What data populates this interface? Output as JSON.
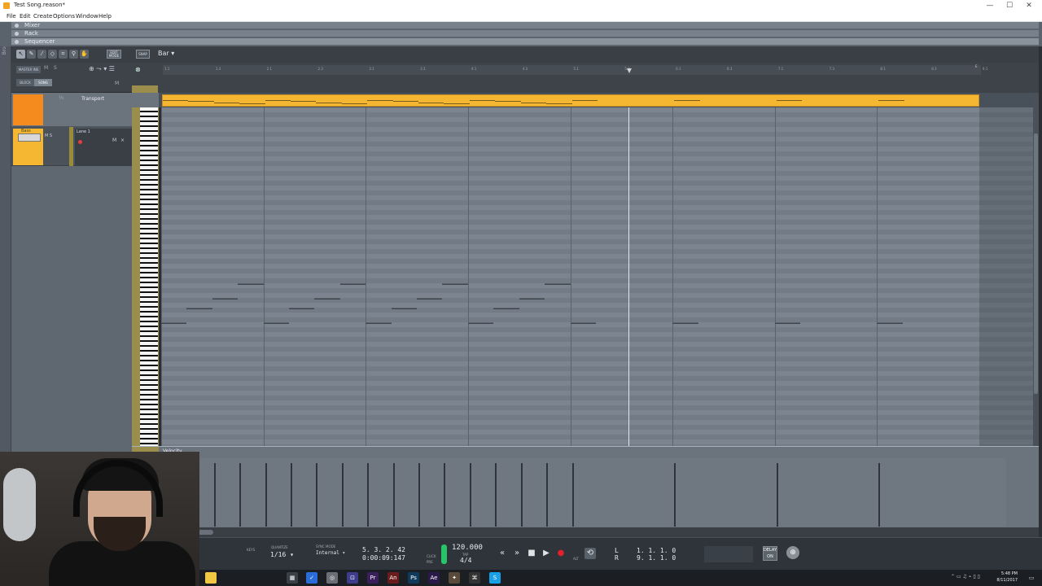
{
  "window": {
    "title": "Test Song.reason*",
    "minimize": "—",
    "maximize": "☐",
    "close": "✕"
  },
  "menu": [
    "File",
    "Edit",
    "Create",
    "Options",
    "Window",
    "Help"
  ],
  "areas": {
    "mixer": "Mixer",
    "rack": "Rack",
    "sequencer": "Sequencer"
  },
  "browser_tab": "Browser",
  "tools": {
    "edit_mode": "EDIT MODE"
  },
  "track_header": {
    "master_inst": "MASTER INS",
    "block": "BLOCK",
    "song": "SONG",
    "m": "M",
    "s": "S",
    "m2": "M"
  },
  "tracks": {
    "transport": {
      "name": "Transport"
    },
    "bass": {
      "device": "Bass",
      "m": "M",
      "s": "S",
      "lane": "Lane 1",
      "lane_m": "M",
      "lane_x": "×"
    }
  },
  "editor": {
    "snap_button": "SNAP",
    "snap_value": "Bar",
    "ruler_ticks": [
      "1.1",
      "1.3",
      "2.1",
      "2.3",
      "3.1",
      "3.3",
      "4.1",
      "4.3",
      "5.1",
      "5.3",
      "6.1",
      "6.3",
      "7.1",
      "7.3",
      "8.1",
      "8.3",
      "9.1"
    ],
    "end_label": "E",
    "velocity_label": "Velocity",
    "bar_count": 8,
    "clip_color": "#f5b731",
    "notes": [
      {
        "start": 1.0,
        "len": 0.25,
        "row": 44
      },
      {
        "start": 1.25,
        "len": 0.25,
        "row": 41
      },
      {
        "start": 1.5,
        "len": 0.25,
        "row": 39
      },
      {
        "start": 1.75,
        "len": 0.25,
        "row": 36
      },
      {
        "start": 2.0,
        "len": 0.25,
        "row": 44
      },
      {
        "start": 2.25,
        "len": 0.25,
        "row": 41
      },
      {
        "start": 2.5,
        "len": 0.25,
        "row": 39
      },
      {
        "start": 2.75,
        "len": 0.25,
        "row": 36
      },
      {
        "start": 3.0,
        "len": 0.25,
        "row": 44
      },
      {
        "start": 3.25,
        "len": 0.25,
        "row": 41
      },
      {
        "start": 3.5,
        "len": 0.25,
        "row": 39
      },
      {
        "start": 3.75,
        "len": 0.25,
        "row": 36
      },
      {
        "start": 4.0,
        "len": 0.25,
        "row": 44
      },
      {
        "start": 4.25,
        "len": 0.25,
        "row": 41
      },
      {
        "start": 4.5,
        "len": 0.25,
        "row": 39
      },
      {
        "start": 4.75,
        "len": 0.25,
        "row": 36
      },
      {
        "start": 5.0,
        "len": 0.25,
        "row": 44
      },
      {
        "start": 6.0,
        "len": 0.25,
        "row": 44
      },
      {
        "start": 7.0,
        "len": 0.25,
        "row": 44
      },
      {
        "start": 8.0,
        "len": 0.25,
        "row": 44
      }
    ],
    "velocities": [
      1.0,
      1.0,
      1.0,
      1.0,
      1.0,
      1.0,
      1.0,
      1.0,
      1.0,
      1.0,
      1.0,
      1.0,
      1.0,
      1.0,
      1.0,
      1.0,
      1.0,
      1.0,
      1.0,
      1.0
    ],
    "playhead_bar": 5.57
  },
  "transport": {
    "keys_label": "KEYS",
    "quantize_label": "QUANTIZE",
    "quantize_value": "1/16",
    "sync_label": "SYNC MODE",
    "sync_value": "Internal",
    "position": "5. 3. 2. 42",
    "time": "0:00:09:147",
    "click_label": "CLICK",
    "pre_label": "PRE",
    "tempo": "120.000",
    "tap_label": "TAP",
    "signature": "4/4",
    "alt_label": "ALT",
    "loop_left_label": "L",
    "loop_right_label": "R",
    "loop_left": "1. 1. 1. 0",
    "loop_right": "9. 1. 1. 0",
    "on_label": "DELAY ON",
    "rewind": "«",
    "forward": "»",
    "stop": "■",
    "play": "▶",
    "record": "●",
    "loop": "⟲",
    "globe": "⊕"
  },
  "taskbar": {
    "time": "5:48 PM",
    "date": "8/11/2017",
    "tray": "⌃ ▭ ♫ ⌁ ▯ ▯"
  }
}
